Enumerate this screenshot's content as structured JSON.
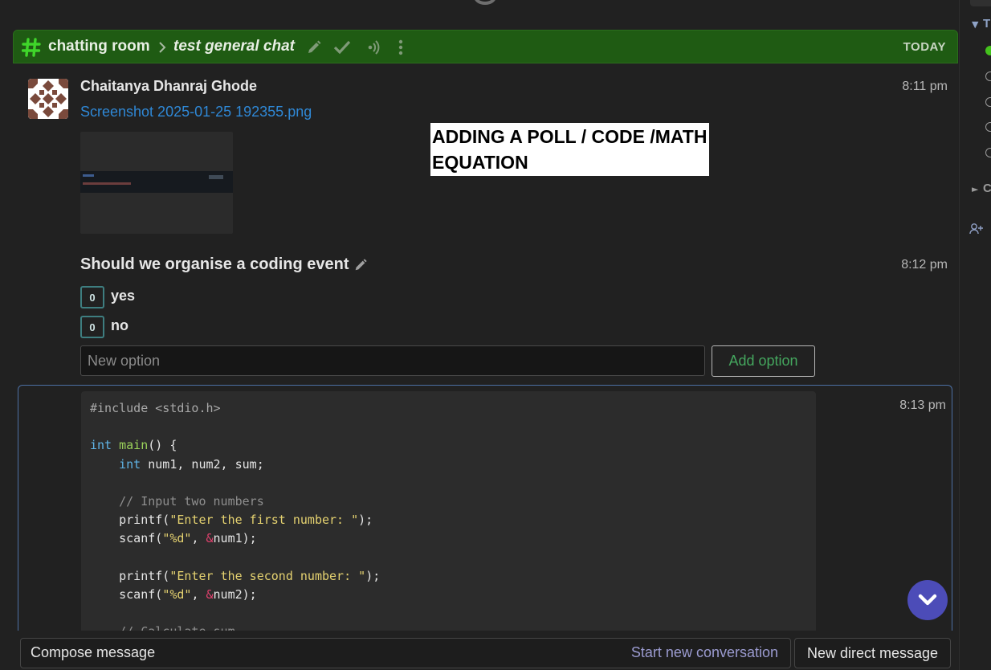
{
  "topic_bar": {
    "stream": "chatting room",
    "topic": "test general chat",
    "date": "TODAY",
    "stream_color": "#1f5b13",
    "icons": [
      "hash-icon",
      "chevron-right-icon",
      "pencil-icon",
      "check-icon",
      "broadcast-icon",
      "vertical-dots-icon"
    ]
  },
  "messages": {
    "first": {
      "sender": "Chaitanya Dhanraj Ghode",
      "time": "8:11 pm",
      "attachment_name": "Screenshot 2025-01-25 192355.png"
    },
    "poll": {
      "time": "8:12 pm",
      "question": "Should we organise a coding event",
      "options": [
        {
          "votes": "0",
          "label": "yes"
        },
        {
          "votes": "0",
          "label": "no"
        }
      ],
      "new_option_placeholder": "New option",
      "add_option_label": "Add option"
    },
    "code": {
      "time": "8:13 pm"
    }
  },
  "overlay_caption": "ADDING A POLL / CODE /MATH EQUATION",
  "compose": {
    "compose_label": "Compose message",
    "new_conversation": "Start new conversation",
    "new_dm": "New direct message"
  },
  "colors": {
    "link": "#2f88d6",
    "add_option": "#44a65e",
    "scroll_button": "#4c4cb8",
    "active_status": "#44c21d"
  }
}
